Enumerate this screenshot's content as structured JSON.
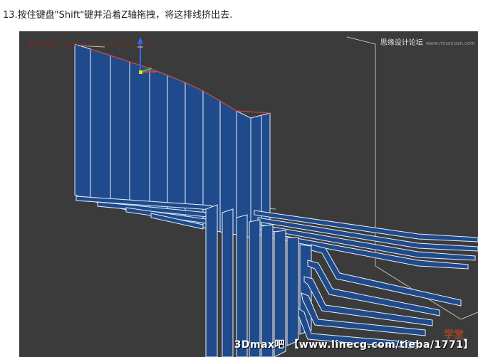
{
  "caption": {
    "text": "13.按住键盘\"Shift\"键并沿着Z轴拖拽，将这排线挤出去."
  },
  "viewport": {
    "watermark_top_left": "思缘设计 www.missyuan.com",
    "watermark_top_right": "思缘设计论坛",
    "watermark_top_right_sub": "www.missyuan.com",
    "watermark_bottom_right": "3Dmax吧 【www.linecg.com/tieba/1771】",
    "watermark_logo_text": "学堂",
    "gizmo": {
      "axes": [
        "x",
        "y",
        "z"
      ]
    },
    "colors": {
      "background": "#3b3b3b",
      "ribbon_fill": "#1f4b8c",
      "ribbon_edge": "#e8eef8",
      "top_edge": "#c84040",
      "gizmo_x": "#e03b3b",
      "gizmo_y": "#3bc43b",
      "gizmo_z": "#2f6bff",
      "gizmo_center": "#ffd400"
    }
  }
}
